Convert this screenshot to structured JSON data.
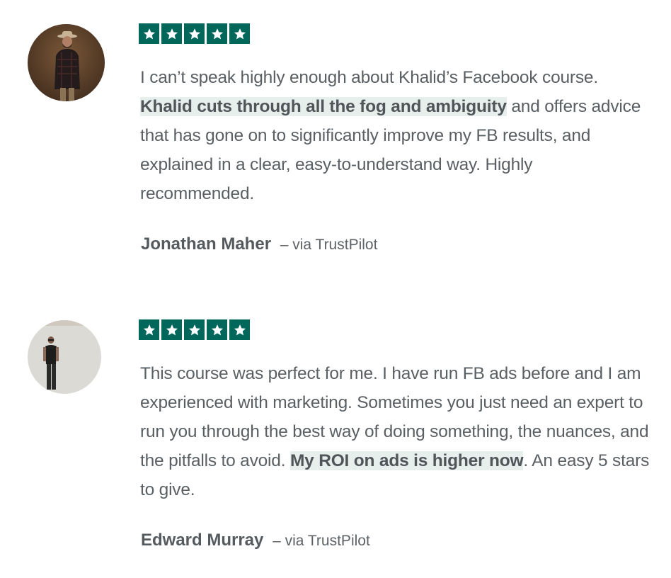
{
  "reviews": [
    {
      "rating": 5,
      "star_color": "#00675a",
      "avatar_icon": "man-with-hat-avatar",
      "text_before": "I can’t speak highly enough about Khalid’s Facebook course. ",
      "text_highlight": "Khalid cuts through all the fog and ambiguity",
      "text_after": " and offers advice that has gone on to significantly improve my FB results, and explained in a clear, easy-to-understand way. Highly recommended.",
      "author": "Jonathan Maher",
      "source": "– via TrustPilot"
    },
    {
      "rating": 5,
      "star_color": "#00675a",
      "avatar_icon": "man-standing-avatar",
      "text_before": "This course was perfect for me. I have run FB ads before and I am experienced with marketing. Sometimes you just need an expert to run you through the best way of doing something, the nuances, and the pitfalls to avoid. ",
      "text_highlight": "My ROI on ads is higher now",
      "text_after": ". An easy 5 stars to give.",
      "author": "Edward Murray",
      "source": "– via TrustPilot"
    }
  ],
  "highlight_color": "#e6efec"
}
